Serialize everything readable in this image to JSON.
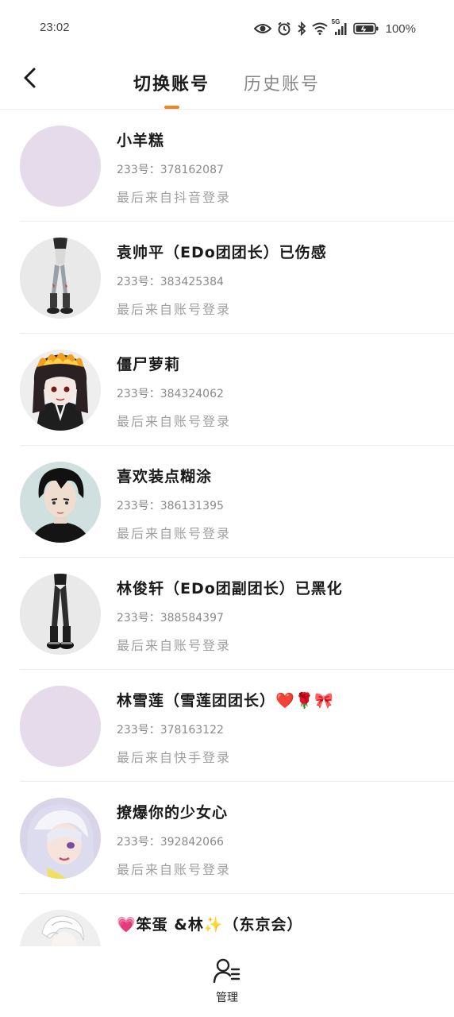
{
  "status_bar": {
    "time": "23:02",
    "battery_percent": "100%",
    "network_label": "5G",
    "icons": [
      "eye-icon",
      "alarm-icon",
      "bluetooth-icon",
      "wifi-icon",
      "signal-icon",
      "battery-icon"
    ]
  },
  "header": {
    "tabs": [
      {
        "label": "切换账号",
        "active": true
      },
      {
        "label": "历史账号",
        "active": false
      }
    ],
    "accent_color": "#f58220"
  },
  "accounts": [
    {
      "name": "小羊糕",
      "uid": "233号：378162087",
      "login_source": "最后来自抖音登录",
      "avatar": "blank-lavender-avatar"
    },
    {
      "name": "袁帅平（EDo团团长）已伤感",
      "uid": "233号：383425384",
      "login_source": "最后来自账号登录",
      "avatar": "character-legs-avatar"
    },
    {
      "name": "僵尸萝莉",
      "uid": "233号：384324062",
      "login_source": "最后来自账号登录",
      "avatar": "zombie-girl-avatar"
    },
    {
      "name": "喜欢装点糊涂",
      "uid": "233号：386131395",
      "login_source": "最后来自账号登录",
      "avatar": "anime-boy-avatar"
    },
    {
      "name": "林俊轩（EDo团副团长）已黑化",
      "uid": "233号：388584397",
      "login_source": "最后来自账号登录",
      "avatar": "dark-legs-avatar"
    },
    {
      "name": "林雪莲（雪莲团团长）❤️🌹🎀",
      "uid": "233号：378163122",
      "login_source": "最后来自快手登录",
      "avatar": "blank-lavender-avatar"
    },
    {
      "name": "撩爆你的少女心",
      "uid": "233号：392842066",
      "login_source": "最后来自账号登录",
      "avatar": "anime-girl-avatar"
    },
    {
      "name": "💗笨蛋 &林✨（东京会）",
      "uid": "",
      "login_source": "",
      "avatar": "sketch-avatar"
    }
  ],
  "bottom_bar": {
    "manage_label": "管理"
  }
}
